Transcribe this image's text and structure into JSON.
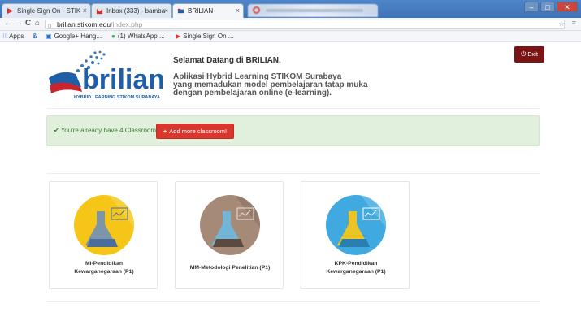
{
  "browser": {
    "tabs": [
      {
        "label": "Single Sign On - STIK",
        "favicon": "sso-icon",
        "active": false
      },
      {
        "label": "Inbox (333) - bamba",
        "favicon": "gmail-icon",
        "active": false
      },
      {
        "label": "BRILIAN",
        "favicon": "brilian-icon",
        "active": true
      }
    ],
    "url_host": "brilian.stikom.edu",
    "url_path": "/index.php",
    "window_buttons": {
      "minimize": "–",
      "maximize": "□",
      "close": "✕"
    },
    "bookmarks": [
      {
        "label": "Apps",
        "icon": "apps-grid-icon"
      },
      {
        "label": "",
        "icon": "delicious-icon"
      },
      {
        "label": "Google+ Hang...",
        "icon": "bookmark-page-icon"
      },
      {
        "label": "(1) WhatsApp ...",
        "icon": "whatsapp-icon"
      },
      {
        "label": "Single Sign On ...",
        "icon": "sso-icon"
      }
    ]
  },
  "header": {
    "logo_text": "brilian",
    "logo_subtitle": "HYBRID LEARNING STIKOM SURABAYA",
    "welcome": "Selamat Datang di BRILIAN,",
    "desc_lines": [
      "Aplikasi Hybrid Learning STIKOM Surabaya",
      "yang memadukan model pembelajaran tatap muka",
      "dengan pembelajaran online (e-learning)."
    ],
    "exit_label": "Exit"
  },
  "alert": {
    "text": "You're already have 4 Classroom",
    "add_label": "Add more classroom!"
  },
  "cards": [
    {
      "title_lines": [
        "MI-Pendidikan",
        "Kewarganegaraan (P1)"
      ],
      "color": "#f5c518",
      "flask": "#6f8fb8"
    },
    {
      "title_lines": [
        "MM-Metodologi Penelitian (P1)"
      ],
      "color": "#a58a78",
      "flask": "#6fb8e0"
    },
    {
      "title_lines": [
        "KPK-Pendidikan",
        "Kewarganegaraan (P1)"
      ],
      "color": "#3fa9e0",
      "flask": "#f5c518"
    }
  ],
  "colors": {
    "exit": "#7b1414",
    "add": "#d9372e",
    "alert_bg": "#e1f0dc",
    "logo_blue": "#1f5fa8",
    "logo_red": "#c9252c"
  }
}
